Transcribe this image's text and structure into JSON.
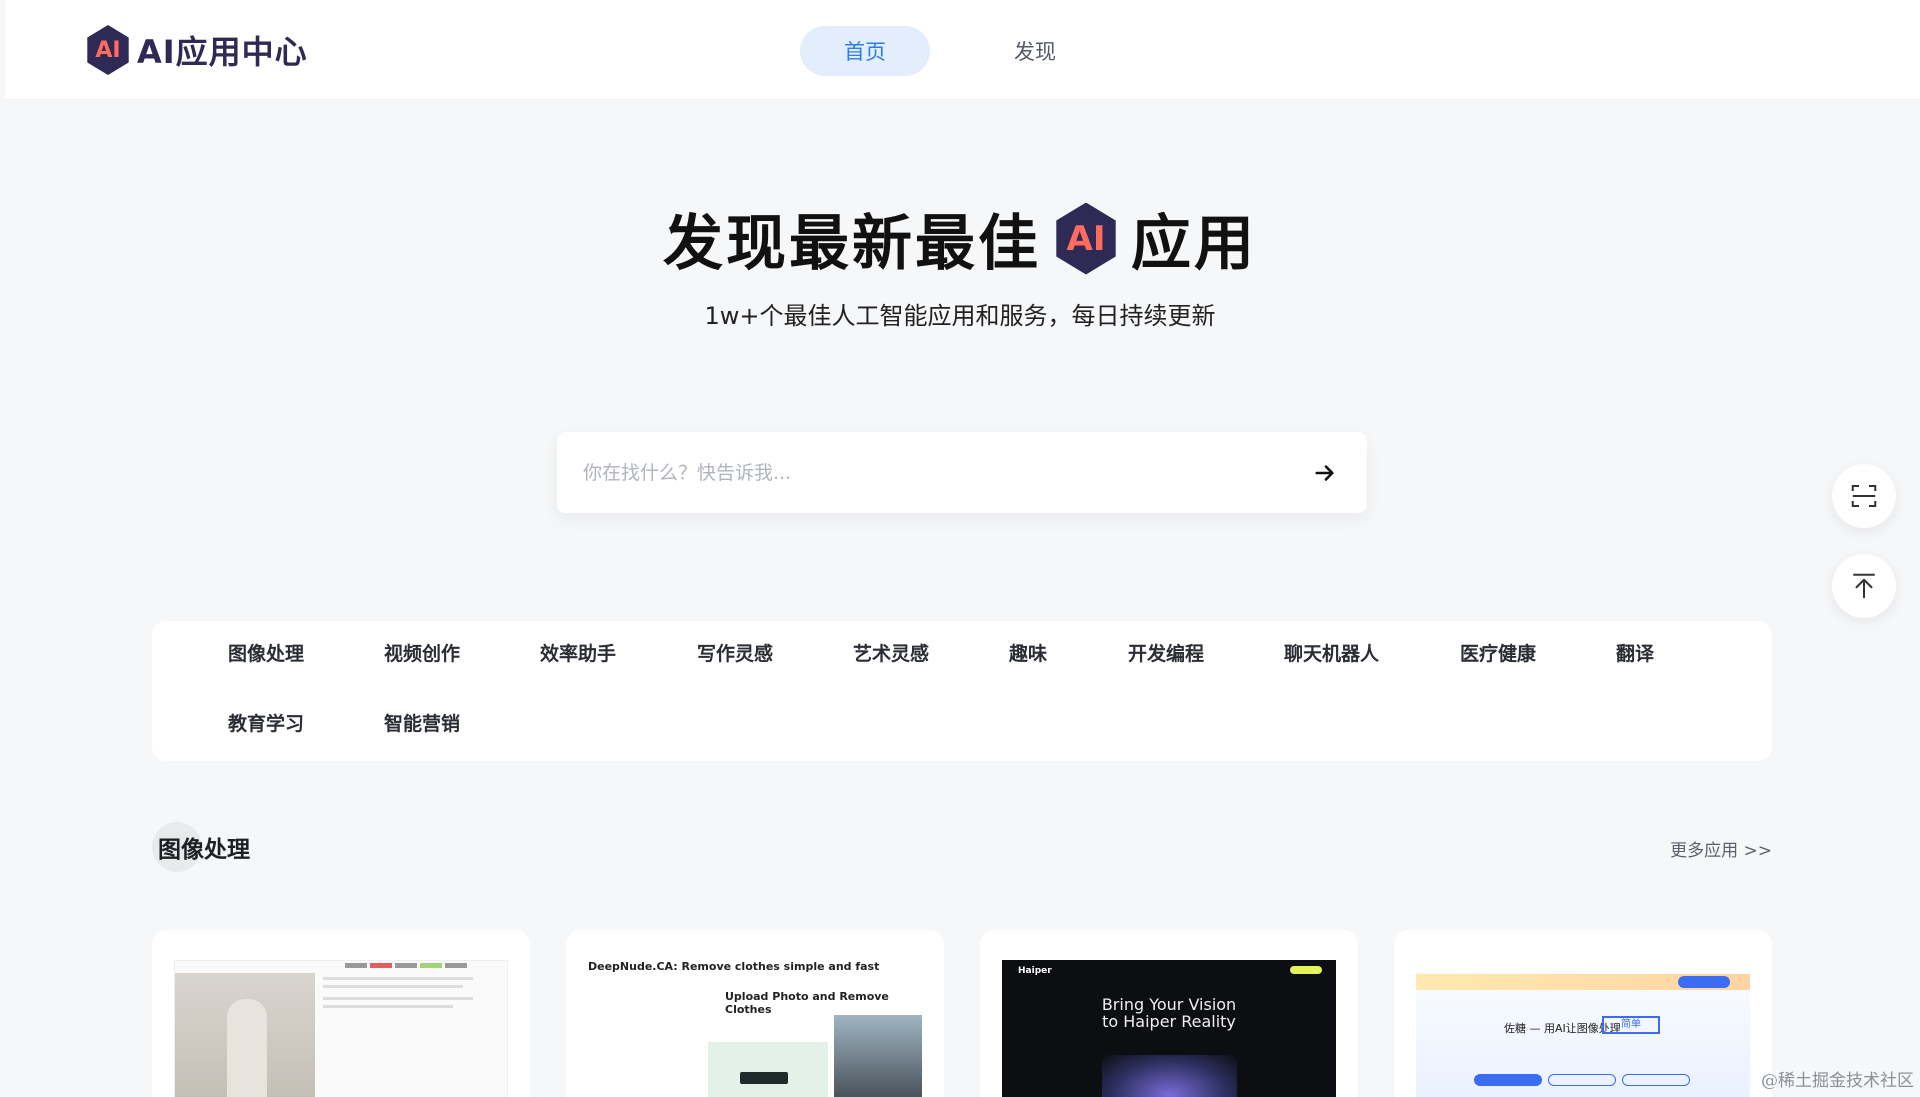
{
  "header": {
    "logo_badge": "AI",
    "logo_text": "AI应用中心",
    "nav": [
      {
        "label": "首页",
        "active": true
      },
      {
        "label": "发现",
        "active": false
      }
    ]
  },
  "hero": {
    "title_before": "发现最新最佳",
    "title_badge": "AI",
    "title_after": "应用",
    "subtitle": "1w+个最佳人工智能应用和服务，每日持续更新"
  },
  "search": {
    "placeholder": "你在找什么？快告诉我...",
    "value": "",
    "submit_icon": "arrow-right-icon"
  },
  "floating": {
    "scan_icon": "scan-frame-icon",
    "top_icon": "back-to-top-icon"
  },
  "categories": [
    "图像处理",
    "视频创作",
    "效率助手",
    "写作灵感",
    "艺术灵感",
    "趣味",
    "开发编程",
    "聊天机器人",
    "医疗健康",
    "翻译",
    "教育学习",
    "智能营销"
  ],
  "section": {
    "title": "图像处理",
    "more_label": "更多应用 >>"
  },
  "cards": [
    {
      "thumb_text": ""
    },
    {
      "thumb_title": "DeepNude.CA: Remove clothes simple and fast",
      "thumb_sub": "Upload Photo and Remove Clothes"
    },
    {
      "thumb_brand": "Haiper",
      "thumb_headline_1": "Bring Your Vision",
      "thumb_headline_2": "to Haiper Reality"
    },
    {
      "thumb_heading": "佐糖 — 用AI让图像处理",
      "thumb_box": "简单"
    }
  ],
  "watermark": "@稀土掘金技术社区",
  "colors": {
    "accent": "#2f7ce8",
    "brand_dark": "#2f2a55",
    "brand_coral": "#ff6b5e",
    "page_bg": "#f6f7f9"
  }
}
